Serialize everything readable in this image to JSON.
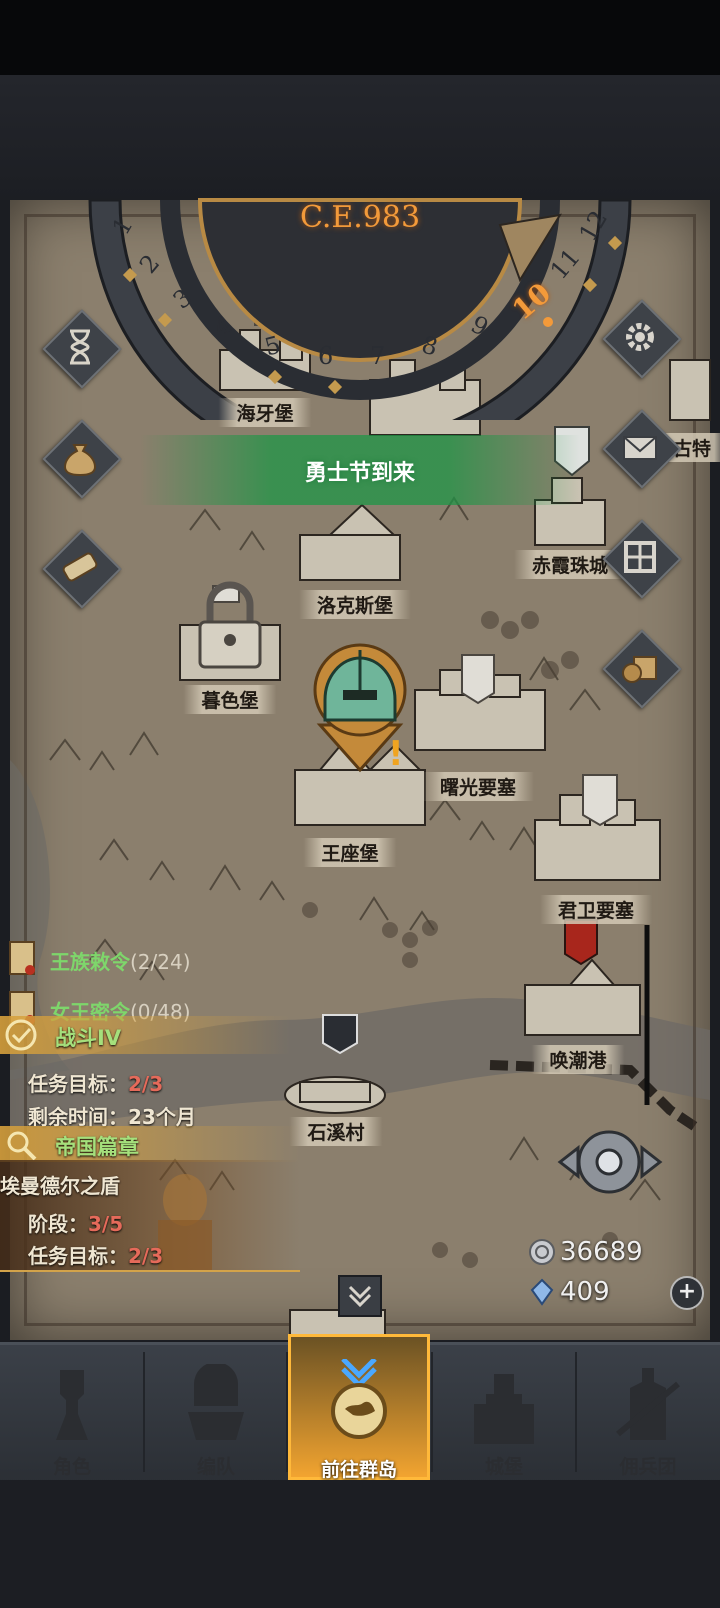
{
  "year": "C.E.983",
  "wheel_numbers": [
    "1",
    "2",
    "3",
    "4",
    "5",
    "6",
    "7",
    "8",
    "9",
    "10",
    "11",
    "12"
  ],
  "wheel_current": "10",
  "event_banner": "勇士节到来",
  "cities": [
    {
      "id": "haiya",
      "name": "海牙堡"
    },
    {
      "id": "luokesi",
      "name": "洛克斯堡"
    },
    {
      "id": "muse",
      "name": "暮色堡"
    },
    {
      "id": "shuguang",
      "name": "曙光要塞"
    },
    {
      "id": "wangzuo",
      "name": "王座堡"
    },
    {
      "id": "junwei",
      "name": "君卫要塞"
    },
    {
      "id": "huanchao",
      "name": "唤潮港"
    },
    {
      "id": "shixi",
      "name": "石溪村"
    },
    {
      "id": "chixia",
      "name": "赤霞珠城"
    },
    {
      "id": "gute",
      "name": "古特"
    }
  ],
  "quests": [
    {
      "name": "王族敕令",
      "count": "(2/24)"
    },
    {
      "name": "女王密令",
      "count": "(0/48)"
    }
  ],
  "battle": {
    "title": "战斗IV",
    "goal_label": "任务目标：",
    "goal_value": "2/3",
    "time_label": "剩余时间：",
    "time_value": "23个月"
  },
  "chapter": {
    "title": "帝国篇章",
    "subtitle": "埃曼德尔之盾",
    "stage_label": "阶段：",
    "stage_value": "3/5",
    "goal_label": "任务目标：",
    "goal_value": "2/3"
  },
  "currency": {
    "silver": "36689",
    "crystal": "409"
  },
  "nav": [
    {
      "label": "角色",
      "icon": "knight-icon"
    },
    {
      "label": "编队",
      "icon": "squad-icon"
    },
    {
      "label": "前往群岛",
      "icon": "islands-icon",
      "active": true
    },
    {
      "label": "城堡",
      "icon": "castle-icon"
    },
    {
      "label": "佣兵团",
      "icon": "mercenary-icon"
    }
  ],
  "colors": {
    "accent_orange": "#f39a3a",
    "quest_green": "#7ed66b",
    "event_green": "#1e9646",
    "nav_active": "#f2a430",
    "map_parchment": "#8b7f6d"
  }
}
